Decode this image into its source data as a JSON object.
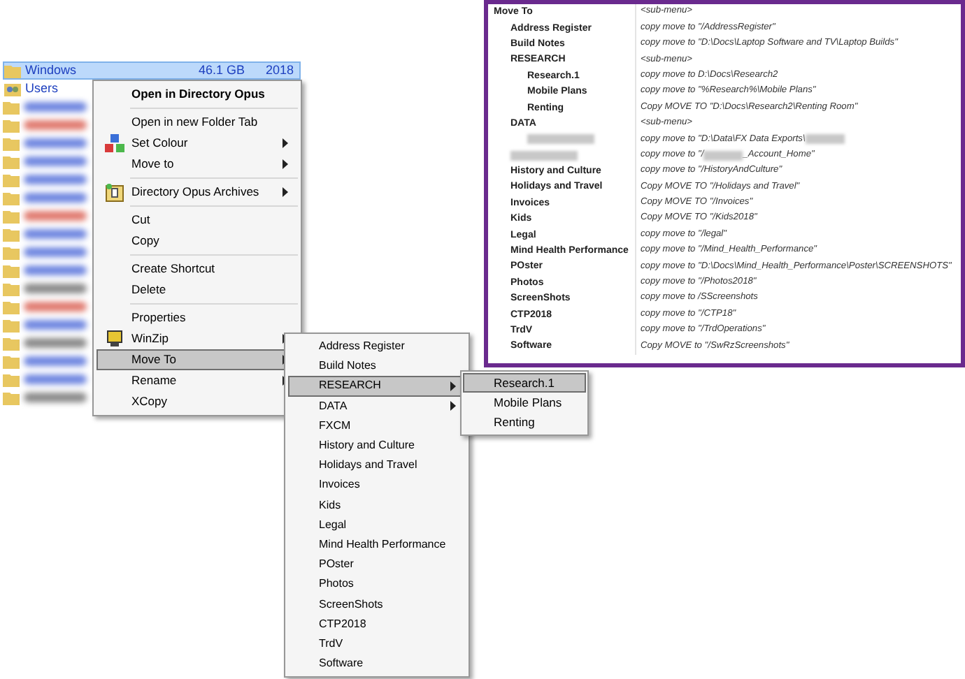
{
  "file_list": {
    "rows": [
      {
        "kind": "folder",
        "name": "Windows",
        "size": "46.1 GB",
        "date": "2018",
        "selected": true
      },
      {
        "kind": "users",
        "name": "Users",
        "selected": false
      },
      {
        "kind": "blurred",
        "color": "#6f86e0"
      },
      {
        "kind": "blurred",
        "color": "#e07a6f"
      },
      {
        "kind": "blurred",
        "color": "#6f86e0"
      },
      {
        "kind": "blurred",
        "color": "#6f86e0"
      },
      {
        "kind": "blurred",
        "color": "#6f86e0"
      },
      {
        "kind": "blurred",
        "color": "#6f86e0"
      },
      {
        "kind": "blurred",
        "color": "#e07a6f"
      },
      {
        "kind": "blurred",
        "color": "#6f86e0"
      },
      {
        "kind": "blurred",
        "color": "#6f86e0"
      },
      {
        "kind": "blurred",
        "color": "#6f86e0"
      },
      {
        "kind": "blurred",
        "color": "#8a8a8a"
      },
      {
        "kind": "blurred",
        "color": "#e07a6f"
      },
      {
        "kind": "blurred",
        "color": "#6f86e0"
      },
      {
        "kind": "blurred",
        "color": "#8a8a8a"
      },
      {
        "kind": "blurred",
        "color": "#6f86e0"
      },
      {
        "kind": "blurred",
        "color": "#6f86e0"
      },
      {
        "kind": "blurred",
        "color": "#8a8a8a"
      }
    ]
  },
  "context_menu": {
    "items": [
      {
        "kind": "item",
        "label": "Open in Directory Opus",
        "bold": true,
        "submenu": false,
        "selected": false
      },
      {
        "kind": "separator"
      },
      {
        "kind": "item",
        "label": "Open in new Folder Tab",
        "bold": false,
        "submenu": false,
        "selected": false
      },
      {
        "kind": "item",
        "label": "Set Colour",
        "bold": false,
        "submenu": true,
        "selected": false
      },
      {
        "kind": "item",
        "label": "Move to",
        "bold": false,
        "submenu": true,
        "selected": false
      },
      {
        "kind": "separator"
      },
      {
        "kind": "item",
        "label": "Directory Opus Archives",
        "bold": false,
        "submenu": true,
        "selected": false
      },
      {
        "kind": "separator"
      },
      {
        "kind": "item",
        "label": "Cut",
        "bold": false,
        "submenu": false,
        "selected": false
      },
      {
        "kind": "item",
        "label": "Copy",
        "bold": false,
        "submenu": false,
        "selected": false
      },
      {
        "kind": "separator"
      },
      {
        "kind": "item",
        "label": "Create Shortcut",
        "bold": false,
        "submenu": false,
        "selected": false
      },
      {
        "kind": "item",
        "label": "Delete",
        "bold": false,
        "submenu": false,
        "selected": false
      },
      {
        "kind": "separator"
      },
      {
        "kind": "item",
        "label": "Properties",
        "bold": false,
        "submenu": false,
        "selected": false
      },
      {
        "kind": "item",
        "label": "WinZip",
        "bold": false,
        "submenu": true,
        "selected": false
      },
      {
        "kind": "item",
        "label": "Move To",
        "bold": false,
        "submenu": true,
        "selected": true
      },
      {
        "kind": "item",
        "label": "Rename",
        "bold": false,
        "submenu": true,
        "selected": false
      },
      {
        "kind": "item",
        "label": "XCopy",
        "bold": false,
        "submenu": false,
        "selected": false
      }
    ]
  },
  "move_to_menu": {
    "items": [
      {
        "label": "Address Register",
        "submenu": false,
        "selected": false
      },
      {
        "label": "Build Notes",
        "submenu": false,
        "selected": false
      },
      {
        "label": "RESEARCH",
        "submenu": true,
        "selected": true
      },
      {
        "label": "DATA",
        "submenu": true,
        "selected": false
      },
      {
        "label": "FXCM",
        "submenu": false,
        "selected": false
      },
      {
        "label": "History and Culture",
        "submenu": false,
        "selected": false
      },
      {
        "label": "Holidays and Travel",
        "submenu": false,
        "selected": false
      },
      {
        "label": "Invoices",
        "submenu": false,
        "selected": false
      },
      {
        "label": "Kids",
        "submenu": false,
        "selected": false
      },
      {
        "label": "Legal",
        "submenu": false,
        "selected": false
      },
      {
        "label": "Mind Health Performance",
        "submenu": false,
        "selected": false
      },
      {
        "label": "POster",
        "submenu": false,
        "selected": false
      },
      {
        "label": "Photos",
        "submenu": false,
        "selected": false
      },
      {
        "label": "ScreenShots",
        "submenu": false,
        "selected": false
      },
      {
        "label": "CTP2018",
        "submenu": false,
        "selected": false
      },
      {
        "label": "TrdV",
        "submenu": false,
        "selected": false
      },
      {
        "label": "Software",
        "submenu": false,
        "selected": false
      }
    ]
  },
  "research_menu": {
    "items": [
      {
        "label": "Research.1",
        "selected": true
      },
      {
        "label": "Mobile Plans",
        "selected": false
      },
      {
        "label": "Renting",
        "selected": false
      }
    ]
  },
  "config_panel": {
    "entries": [
      {
        "name": "Move To",
        "value": [
          {
            "text": "<sub-menu>"
          }
        ],
        "children": [
          {
            "name": "Address Register",
            "value": [
              {
                "text": "copy move to \"/AddressRegister\""
              }
            ]
          },
          {
            "name": "Build Notes",
            "value": [
              {
                "text": "copy move to \"D:\\Docs\\Laptop Software and TV\\Laptop Builds\""
              }
            ]
          },
          {
            "name": "RESEARCH",
            "value": [
              {
                "text": "<sub-menu>"
              }
            ],
            "children": [
              {
                "name": "Research.1",
                "value": [
                  {
                    "text": "copy move to D:\\Docs\\Research2"
                  }
                ]
              },
              {
                "name": "Mobile Plans",
                "value": [
                  {
                    "text": "copy move to \"%Research%\\Mobile Plans\""
                  }
                ]
              },
              {
                "name": "Renting",
                "value": [
                  {
                    "text": "Copy MOVE TO \"D:\\Docs\\Research2\\Renting Room\""
                  }
                ]
              }
            ]
          },
          {
            "name": "DATA",
            "value": [
              {
                "text": "<sub-menu>"
              }
            ],
            "children": [
              {
                "redacted": true,
                "value": [
                  {
                    "text": "copy move to \"D:\\Data\\FX Data Exports\\"
                  },
                  {
                    "redacted": true
                  }
                ]
              }
            ]
          },
          {
            "redacted": true,
            "value": [
              {
                "text": "copy move to \"/"
              },
              {
                "redacted": true
              },
              {
                "text": "_Account_Home\""
              }
            ]
          },
          {
            "name": "History and Culture",
            "value": [
              {
                "text": "copy move to \"/HistoryAndCulture\""
              }
            ]
          },
          {
            "name": "Holidays and Travel",
            "value": [
              {
                "text": "Copy MOVE TO \"/Holidays and Travel\""
              }
            ]
          },
          {
            "name": "Invoices",
            "value": [
              {
                "text": "Copy MOVE TO \"/Invoices\""
              }
            ]
          },
          {
            "name": "Kids",
            "value": [
              {
                "text": "Copy MOVE TO \"/Kids2018\""
              }
            ]
          },
          {
            "name": "Legal",
            "value": [
              {
                "text": "copy move to \"/legal\""
              }
            ]
          },
          {
            "name": "Mind Health Performance",
            "value": [
              {
                "text": "copy move to \"/Mind_Health_Performance\""
              }
            ]
          },
          {
            "name": "POster",
            "value": [
              {
                "text": "copy move to \"D:\\Docs\\Mind_Health_Performance\\Poster\\SCREENSHOTS\""
              }
            ]
          },
          {
            "name": "Photos",
            "value": [
              {
                "text": "copy move to \"/Photos2018\""
              }
            ]
          },
          {
            "name": "ScreenShots",
            "value": [
              {
                "text": "copy move to /SScreenshots"
              }
            ]
          },
          {
            "name": "CTP2018",
            "value": [
              {
                "text": "copy move to \"/CTP18\""
              }
            ]
          },
          {
            "name": "TrdV",
            "value": [
              {
                "text": "copy move to \"/TrdOperations\""
              }
            ]
          },
          {
            "name": "Software",
            "value": [
              {
                "text": "Copy MOVE to \"/SwRzScreenshots\""
              }
            ]
          }
        ]
      }
    ]
  }
}
